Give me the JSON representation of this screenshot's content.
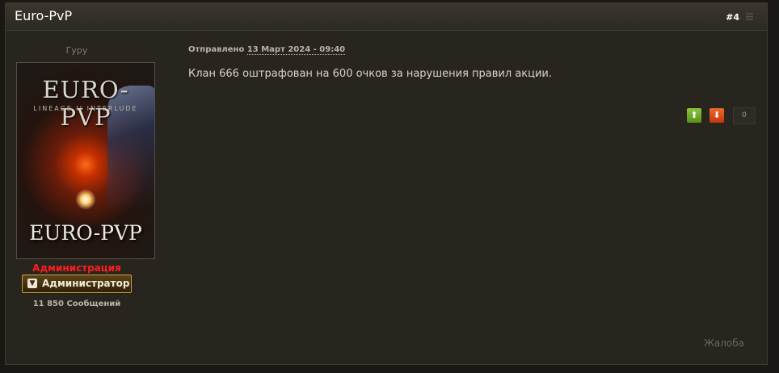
{
  "post": {
    "author": "Euro-PvP",
    "number": "#4",
    "member_title": "Гуру",
    "avatar_text_top": "EURO-PVP",
    "avatar_text_sub": "LINEAGE II INTERLUDE",
    "avatar_text_bottom": "EURO-PVP",
    "group": "Администрация",
    "rank": "Администратор",
    "post_count": "11 850 Сообщений",
    "date_label": "Отправлено",
    "date_value": "13 Март 2024 - 09:40",
    "body": "Клан 666 оштрафован на 600 очков за нарушения правил акции.",
    "reputation": "0",
    "report": "Жалоба",
    "icons": {
      "vote_up": "arrow-up-icon",
      "vote_down": "arrow-down-icon",
      "menu": "post-menu-icon",
      "rank": "rank-chevron-icon"
    },
    "colors": {
      "group": "#ff1e1e",
      "vote_up": "#6aa51f",
      "vote_down": "#e0531a",
      "background": "#28251f"
    }
  }
}
